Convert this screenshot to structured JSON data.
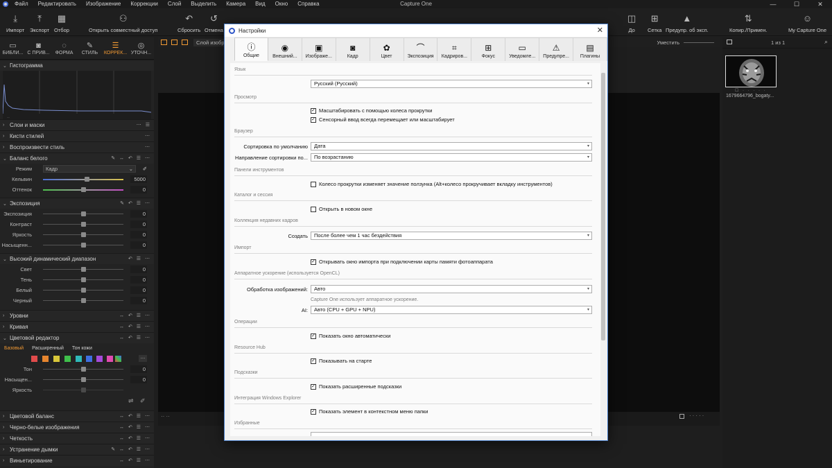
{
  "app_title": "Capture One",
  "menu": [
    "Файл",
    "Редактировать",
    "Изображение",
    "Коррекции",
    "Слой",
    "Выделить",
    "Камера",
    "Вид",
    "Окно",
    "Справка"
  ],
  "toolbar": {
    "import": "Импорт",
    "export": "Экспорт",
    "cull": "Отбор",
    "share": "Открыть совместный доступ",
    "reset": "Сбросить",
    "undo": "Отмена",
    "before": "До",
    "grid": "Сетка",
    "exposure_warning": "Предупр. об эксп.",
    "copy_apply": "Копир./Примен.",
    "my_capture_one": "My Capture One"
  },
  "left_tabs": [
    {
      "label": "БИБЛИ...",
      "icon": "folder-icon"
    },
    {
      "label": "С ПРИВ...",
      "icon": "camera-icon"
    },
    {
      "label": "ФОРМА",
      "icon": "lens-icon"
    },
    {
      "label": "СТИЛЬ",
      "icon": "brush-icon"
    },
    {
      "label": "КОРРЕК...",
      "icon": "sliders-icon",
      "active": true
    },
    {
      "label": "УТОЧН...",
      "icon": "focus-icon"
    }
  ],
  "left_panel": {
    "histogram": "Гистограмма",
    "layers": "Слои и маски",
    "brushes": "Кисти стилей",
    "play_style": "Воспроизвести стиль",
    "white_balance": {
      "title": "Баланс белого",
      "mode_label": "Режим",
      "mode_value": "Кадр",
      "kelvin_label": "Кельвин",
      "kelvin_value": "5000",
      "tint_label": "Оттенок",
      "tint_value": "0"
    },
    "exposure": {
      "title": "Экспозиция",
      "rows": [
        {
          "label": "Экспозиция",
          "value": "0"
        },
        {
          "label": "Контраст",
          "value": "0"
        },
        {
          "label": "Яркость",
          "value": "0"
        },
        {
          "label": "Насыщенн...",
          "value": "0"
        }
      ]
    },
    "hdr": {
      "title": "Высокий динамический диапазон",
      "rows": [
        {
          "label": "Свет",
          "value": "0"
        },
        {
          "label": "Тень",
          "value": "0"
        },
        {
          "label": "Белый",
          "value": "0"
        },
        {
          "label": "Черный",
          "value": "0"
        }
      ]
    },
    "levels": "Уровни",
    "curve": "Кривая",
    "color_editor": {
      "title": "Цветовой редактор",
      "tabs": [
        "Базовый",
        "Расширенный",
        "Тон кожи"
      ],
      "rows": [
        {
          "label": "Тон",
          "value": "0"
        },
        {
          "label": "Насыщен...",
          "value": "0"
        },
        {
          "label": "Яркость",
          "value": ""
        }
      ]
    },
    "bottom_sections": [
      "Цветовой баланс",
      "Черно-белые изображения",
      "Четкость",
      "Устранение дымки",
      "Виньетирование"
    ]
  },
  "viewer": {
    "tab": "Слой изобр",
    "fit": "Уместить"
  },
  "right_panel": {
    "count": "1 из 1",
    "thumb_name": "1679664796_bogaty..."
  },
  "dialog": {
    "title": "Настройки",
    "tabs": [
      {
        "label": "Общие",
        "icon": "info-icon",
        "active": true
      },
      {
        "label": "Внешний...",
        "icon": "eye-icon"
      },
      {
        "label": "Изображе...",
        "icon": "image-icon"
      },
      {
        "label": "Кадр",
        "icon": "camera-icon"
      },
      {
        "label": "Цвет",
        "icon": "color-icon"
      },
      {
        "label": "Экспозиция",
        "icon": "exposure-icon"
      },
      {
        "label": "Кадриров...",
        "icon": "crop-icon"
      },
      {
        "label": "Фокус",
        "icon": "focus-icon"
      },
      {
        "label": "Уведомле...",
        "icon": "message-icon"
      },
      {
        "label": "Предупре...",
        "icon": "warning-icon"
      },
      {
        "label": "Плагины",
        "icon": "plugin-icon"
      }
    ],
    "sections": {
      "language": {
        "title": "Язык",
        "value": "Русский (Русский)"
      },
      "preview": {
        "title": "Просмотр",
        "checks": [
          "Масштабировать с помощью колеса прокрутки",
          "Сенсорный ввод всегда перемещает или масштабирует"
        ]
      },
      "browser": {
        "title": "Браузер",
        "sort_label": "Сортировка по умолчанию",
        "sort_value": "Дата",
        "dir_label": "Направление сортировки по...",
        "dir_value": "По возрастанию"
      },
      "toolpanels": {
        "title": "Панели инструментов",
        "check": "Колесо прокрутки изменяет значение ползунка (Alt+колесо прокручивает вкладку инструментов)"
      },
      "catalog": {
        "title": "Каталог и сессия",
        "check": "Открыть в новом окне"
      },
      "recent": {
        "title": "Коллекция недавних кадров",
        "create_label": "Создать",
        "create_value": "После более чем 1 час бездействия"
      },
      "import": {
        "title": "Импорт",
        "check": "Открывать окно импорта при подключении карты памяти фотоаппарата"
      },
      "accel": {
        "title": "Аппаратное ускорение (используется OpenCL)",
        "proc_label": "Обработка изображений:",
        "proc_value": "Авто",
        "note": "Capture One использует аппаратное ускорение.",
        "ai_label": "AI:",
        "ai_value": "Авто (CPU + GPU + NPU)"
      },
      "operations": {
        "title": "Операции",
        "check": "Показать окно автоматически"
      },
      "resource": {
        "title": "Resource Hub",
        "check": "Показывать на старте"
      },
      "hints": {
        "title": "Подсказки",
        "check": "Показать расширенные подсказки"
      },
      "explorer": {
        "title": "Интеграция Windows Explorer",
        "check": "Показать элемент в контекстном меню папки"
      },
      "favorites": {
        "title": "Избранные"
      }
    }
  }
}
